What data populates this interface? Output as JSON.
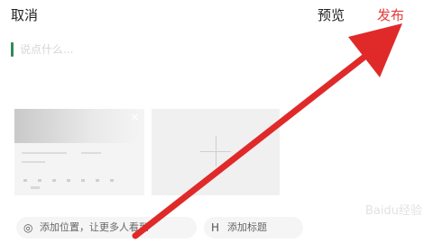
{
  "header": {
    "cancel_label": "取消",
    "preview_label": "预览",
    "publish_label": "发布"
  },
  "composer": {
    "placeholder": "说点什么..."
  },
  "thumbnail": {
    "close_icon": "close-icon"
  },
  "add_media": {
    "icon": "plus-icon"
  },
  "chips": {
    "location_label": "添加位置，让更多人看到",
    "location_icon": "location-pin-icon",
    "topic_label": "添加标题",
    "topic_icon": "heading-icon"
  },
  "watermark": "Baidu经验",
  "colors": {
    "accent": "#e23b3b",
    "caret": "#2e8b57",
    "arrow": "#e02a2a"
  }
}
